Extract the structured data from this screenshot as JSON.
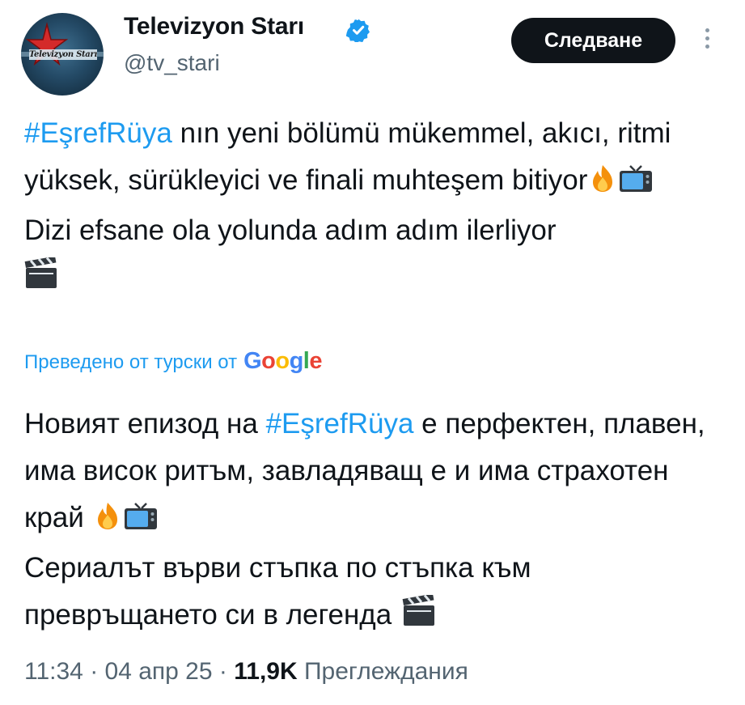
{
  "account": {
    "display_name": "Televizyon Starı",
    "handle": "@tv_stari",
    "verified_icon": "verified-badge-icon",
    "avatar_text": "Televizyon Starı",
    "avatar_icon": "red-star-logo-icon"
  },
  "actions": {
    "follow_label": "Следване",
    "more_icon": "vertical-ellipsis-icon"
  },
  "tweet": {
    "hashtag": "#EşrefRüya",
    "line1_rest": " nın yeni bölümü mükemmel, akıcı, ritmi yüksek, sürükleyici ve finali muhteşem bitiyor",
    "line2": "Dizi efsane ola yolunda adım adım ilerliyor",
    "emojis": [
      "fire-emoji",
      "television-emoji",
      "clapper-board-emoji"
    ]
  },
  "translation_notice": {
    "label": "Преведено от турски от",
    "provider": "Google"
  },
  "translation": {
    "part1": "Новият епизод на ",
    "hashtag": "#EşrefRüya",
    "part2": " е перфектен, плавен, има висок ритъм, завладяващ е и има страхотен край ",
    "line2": "Сериалът върви стъпка по стъпка към превръщането си в легенда "
  },
  "meta": {
    "time": "11:34",
    "sep1": " · ",
    "date": "04 апр 25",
    "sep2": " · ",
    "views_count": "11,9K",
    "views_label": " Преглеждания"
  },
  "colors": {
    "accent": "#1d9bf0",
    "text": "#0f1419",
    "secondary": "#536471",
    "button_bg": "#0f1419"
  }
}
